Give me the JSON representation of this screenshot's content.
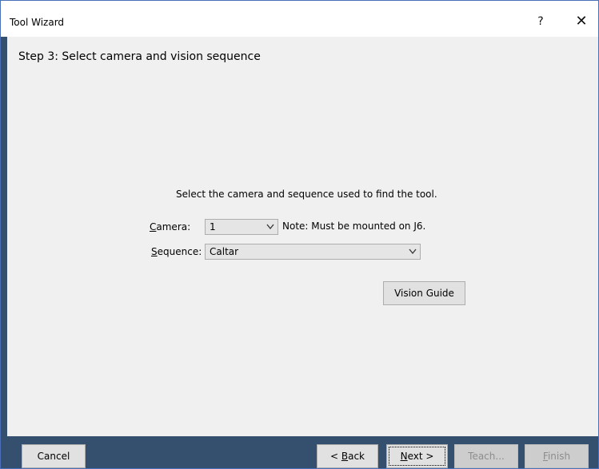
{
  "window": {
    "title": "Tool Wizard",
    "help_glyph": "?",
    "close_glyph": "✕"
  },
  "step": {
    "title": "Step 3: Select camera and vision sequence",
    "instruction": "Select the camera and sequence used to find the tool."
  },
  "camera": {
    "label_mnemonic": "C",
    "label_rest": "amera:",
    "value": "1",
    "note": "Note: Must be mounted on J6."
  },
  "sequence": {
    "label_mnemonic": "S",
    "label_rest": "equence:",
    "value": "Caltar"
  },
  "buttons": {
    "vision_guide": "Vision Guide",
    "cancel": "Cancel",
    "back_prefix": "< ",
    "back_mnemonic": "B",
    "back_rest": "ack",
    "next_mnemonic": "N",
    "next_rest": "ext >",
    "teach": "Teach...",
    "finish_mnemonic": "F",
    "finish_rest": "inish"
  },
  "colors": {
    "frame_dark": "#34506e",
    "window_border": "#4a70b8",
    "disabled_text": "#8d8d8d"
  }
}
